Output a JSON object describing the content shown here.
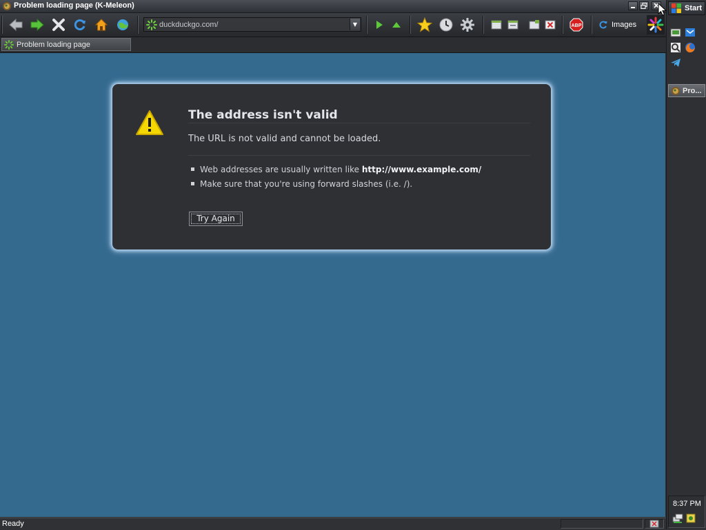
{
  "window": {
    "title": "Problem loading page (K-Meleon)",
    "controls": [
      "minimize",
      "restore",
      "close"
    ]
  },
  "toolbar": {
    "buttons": [
      "back",
      "forward",
      "stop",
      "reload",
      "home",
      "go-online"
    ],
    "url": "duckduckgo.com/",
    "nav_buttons": [
      "go",
      "up"
    ],
    "tool_buttons": [
      "bookmarks",
      "history",
      "preferences"
    ],
    "window_buttons": [
      "new-window",
      "new-window-2",
      "new-tab",
      "close-tab"
    ],
    "abp_label": "ABP",
    "images_label": "Images"
  },
  "tabs": [
    {
      "label": "Problem loading page",
      "active": true
    }
  ],
  "error": {
    "title": "The address isn't valid",
    "description": "The URL is not valid and cannot be loaded.",
    "bullet1_prefix": "Web addresses are usually written like ",
    "bullet1_example": "http://www.example.com/",
    "bullet2": "Make sure that you're using forward slashes (i.e. /).",
    "button": "Try Again"
  },
  "statusbar": {
    "text": "Ready"
  },
  "taskbar": {
    "start_label": "Start",
    "task_label": "Pro...",
    "clock": "8:37 PM"
  },
  "colors": {
    "content_bg": "#356a8f",
    "error_box_bg": "#2f3034",
    "error_box_glow": "#b7d5f2",
    "chrome_bg": "#2f3134",
    "warning_yellow": "#f5d800"
  }
}
